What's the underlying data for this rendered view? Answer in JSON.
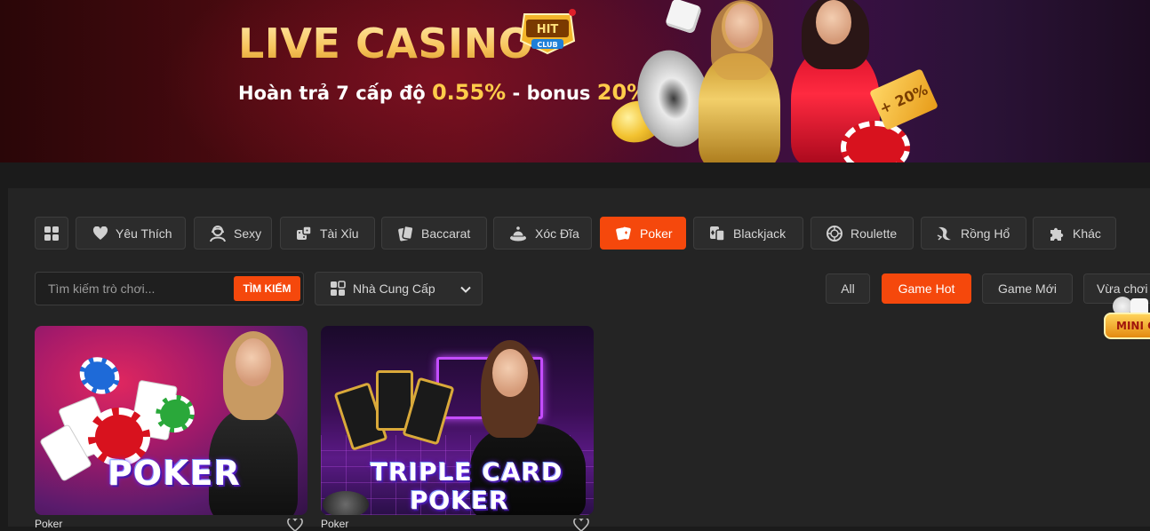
{
  "banner": {
    "title": "LIVE CASINO",
    "logo_text": "HIT CLUB",
    "subtitle_prefix": "Hoàn trả 7 cấp độ ",
    "subtitle_rate": "0.55%",
    "subtitle_mid": " - bonus ",
    "subtitle_bonus": "20%",
    "ticket_text": "+ 20%"
  },
  "categories": [
    {
      "label": "Yêu Thích",
      "icon": "heart-icon"
    },
    {
      "label": "Sexy",
      "icon": "dealer-icon"
    },
    {
      "label": "Tài Xỉu",
      "icon": "dice-icon"
    },
    {
      "label": "Baccarat",
      "icon": "cards-icon"
    },
    {
      "label": "Xóc Đĩa",
      "icon": "plate-icon"
    },
    {
      "label": "Poker",
      "icon": "poker-icon",
      "active": true
    },
    {
      "label": "Blackjack",
      "icon": "blackjack-icon"
    },
    {
      "label": "Roulette",
      "icon": "roulette-icon"
    },
    {
      "label": "Rồng Hổ",
      "icon": "dragon-icon"
    },
    {
      "label": "Khác",
      "icon": "puzzle-icon"
    }
  ],
  "search": {
    "placeholder": "Tìm kiếm trò chơi...",
    "button_label": "TÌM KIẾM"
  },
  "provider": {
    "label": "Nhà Cung Cấp"
  },
  "sort_tabs": [
    {
      "label": "All"
    },
    {
      "label": "Game Hot",
      "active": true
    },
    {
      "label": "Game Mới"
    },
    {
      "label": "Vừa chơi"
    }
  ],
  "mini_game": {
    "label": "MINI GAME"
  },
  "games": [
    {
      "title": "POKER",
      "name": "Poker"
    },
    {
      "title_line1": "TRIPLE CARD",
      "title_line2": "POKER",
      "name": "Poker"
    }
  ],
  "colors": {
    "accent": "#f5480c",
    "panel": "#242424",
    "background": "#1b1b1b",
    "gold": "#ffcc4a"
  }
}
